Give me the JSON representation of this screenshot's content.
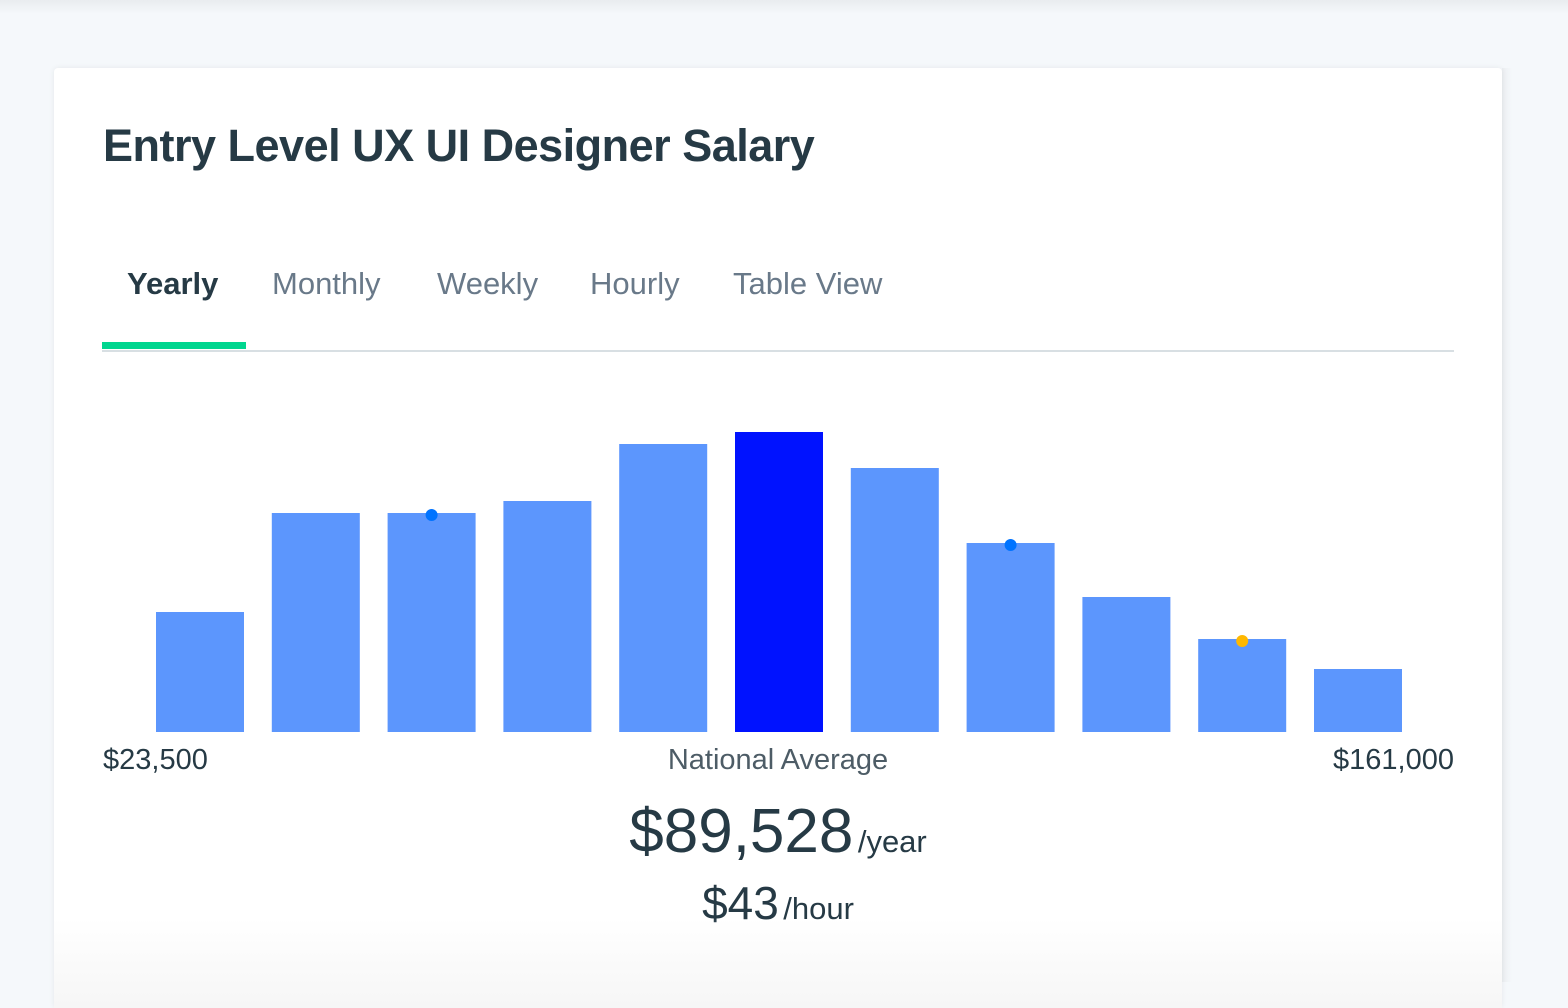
{
  "page": {
    "title": "Entry Level UX UI Designer Salary"
  },
  "tabs": [
    {
      "label": "Yearly",
      "active": true
    },
    {
      "label": "Monthly",
      "active": false
    },
    {
      "label": "Weekly",
      "active": false
    },
    {
      "label": "Hourly",
      "active": false
    },
    {
      "label": "Table View",
      "active": false
    }
  ],
  "colors": {
    "bar": "#5c96fd",
    "highlight_bar": "#0012ff",
    "marker_blue": "#0073ff",
    "marker_yellow": "#ffb800",
    "tab_indicator": "#00d68f"
  },
  "chart_data": {
    "type": "bar",
    "title": "Entry Level UX UI Designer Salary",
    "xlabel": "",
    "ylabel": "",
    "grid": false,
    "legend": "none",
    "categories": [
      "bin-1",
      "bin-2",
      "bin-3",
      "bin-4",
      "bin-5",
      "bin-6",
      "bin-7",
      "bin-8",
      "bin-9",
      "bin-10",
      "bin-11"
    ],
    "values": [
      0.4,
      0.73,
      0.73,
      0.77,
      0.96,
      1.0,
      0.88,
      0.63,
      0.45,
      0.31,
      0.21
    ],
    "value_units": "relative frequency (fraction of tallest bar)",
    "highlight_index": 5,
    "markers": [
      {
        "bar_index": 2,
        "color": "marker_blue"
      },
      {
        "bar_index": 7,
        "color": "marker_blue"
      },
      {
        "bar_index": 9,
        "color": "marker_yellow"
      }
    ],
    "x_range_labels": {
      "min": "$23,500",
      "center": "National Average",
      "max": "$161,000"
    },
    "ylim": [
      0,
      1
    ]
  },
  "summary": {
    "yearly_value": "$89,528",
    "yearly_unit": "/year",
    "hourly_value": "$43",
    "hourly_unit": "/hour"
  }
}
